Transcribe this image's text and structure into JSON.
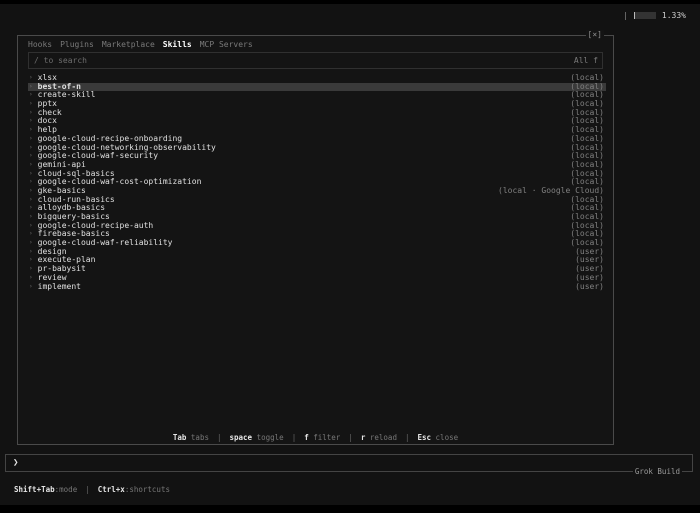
{
  "usage": {
    "percent_label": "1.33%",
    "fill_fraction": 0.05
  },
  "modal": {
    "close_label": "[×]",
    "tabs": [
      {
        "label": "Hooks",
        "active": false
      },
      {
        "label": "Plugins",
        "active": false
      },
      {
        "label": "Marketplace",
        "active": false
      },
      {
        "label": "Skills",
        "active": true
      },
      {
        "label": "MCP Servers",
        "active": false
      }
    ],
    "search": {
      "placeholder": "/ to search",
      "filter": "All f"
    },
    "skills": [
      {
        "name": "xlsx",
        "source": "(local)"
      },
      {
        "name": "best-of-n",
        "source": "(local)",
        "selected": true
      },
      {
        "name": "create-skill",
        "source": "(local)"
      },
      {
        "name": "pptx",
        "source": "(local)"
      },
      {
        "name": "check",
        "source": "(local)"
      },
      {
        "name": "docx",
        "source": "(local)"
      },
      {
        "name": "help",
        "source": "(local)"
      },
      {
        "name": "google-cloud-recipe-onboarding",
        "source": "(local)"
      },
      {
        "name": "google-cloud-networking-observability",
        "source": "(local)"
      },
      {
        "name": "google-cloud-waf-security",
        "source": "(local)"
      },
      {
        "name": "gemini-api",
        "source": "(local)"
      },
      {
        "name": "cloud-sql-basics",
        "source": "(local)"
      },
      {
        "name": "google-cloud-waf-cost-optimization",
        "source": "(local)"
      },
      {
        "name": "gke-basics",
        "source": "(local · Google Cloud)"
      },
      {
        "name": "cloud-run-basics",
        "source": "(local)"
      },
      {
        "name": "alloydb-basics",
        "source": "(local)"
      },
      {
        "name": "bigquery-basics",
        "source": "(local)"
      },
      {
        "name": "google-cloud-recipe-auth",
        "source": "(local)"
      },
      {
        "name": "firebase-basics",
        "source": "(local)"
      },
      {
        "name": "google-cloud-waf-reliability",
        "source": "(local)"
      },
      {
        "name": "design",
        "source": "(user)"
      },
      {
        "name": "execute-plan",
        "source": "(user)"
      },
      {
        "name": "pr-babysit",
        "source": "(user)"
      },
      {
        "name": "review",
        "source": "(user)"
      },
      {
        "name": "implement",
        "source": "(user)"
      }
    ],
    "hints": [
      {
        "key": "Tab",
        "desc": "tabs"
      },
      {
        "key": "space",
        "desc": "toggle"
      },
      {
        "key": "f",
        "desc": "filter"
      },
      {
        "key": "r",
        "desc": "reload"
      },
      {
        "key": "Esc",
        "desc": "close"
      }
    ]
  },
  "prompt": {
    "chevron": "❯"
  },
  "model_label": "Grok Build",
  "status": {
    "mode_key": "Shift+Tab",
    "mode_desc": ":mode",
    "separator": "|",
    "shortcut_key": "Ctrl+x",
    "shortcut_desc": ":shortcuts"
  }
}
